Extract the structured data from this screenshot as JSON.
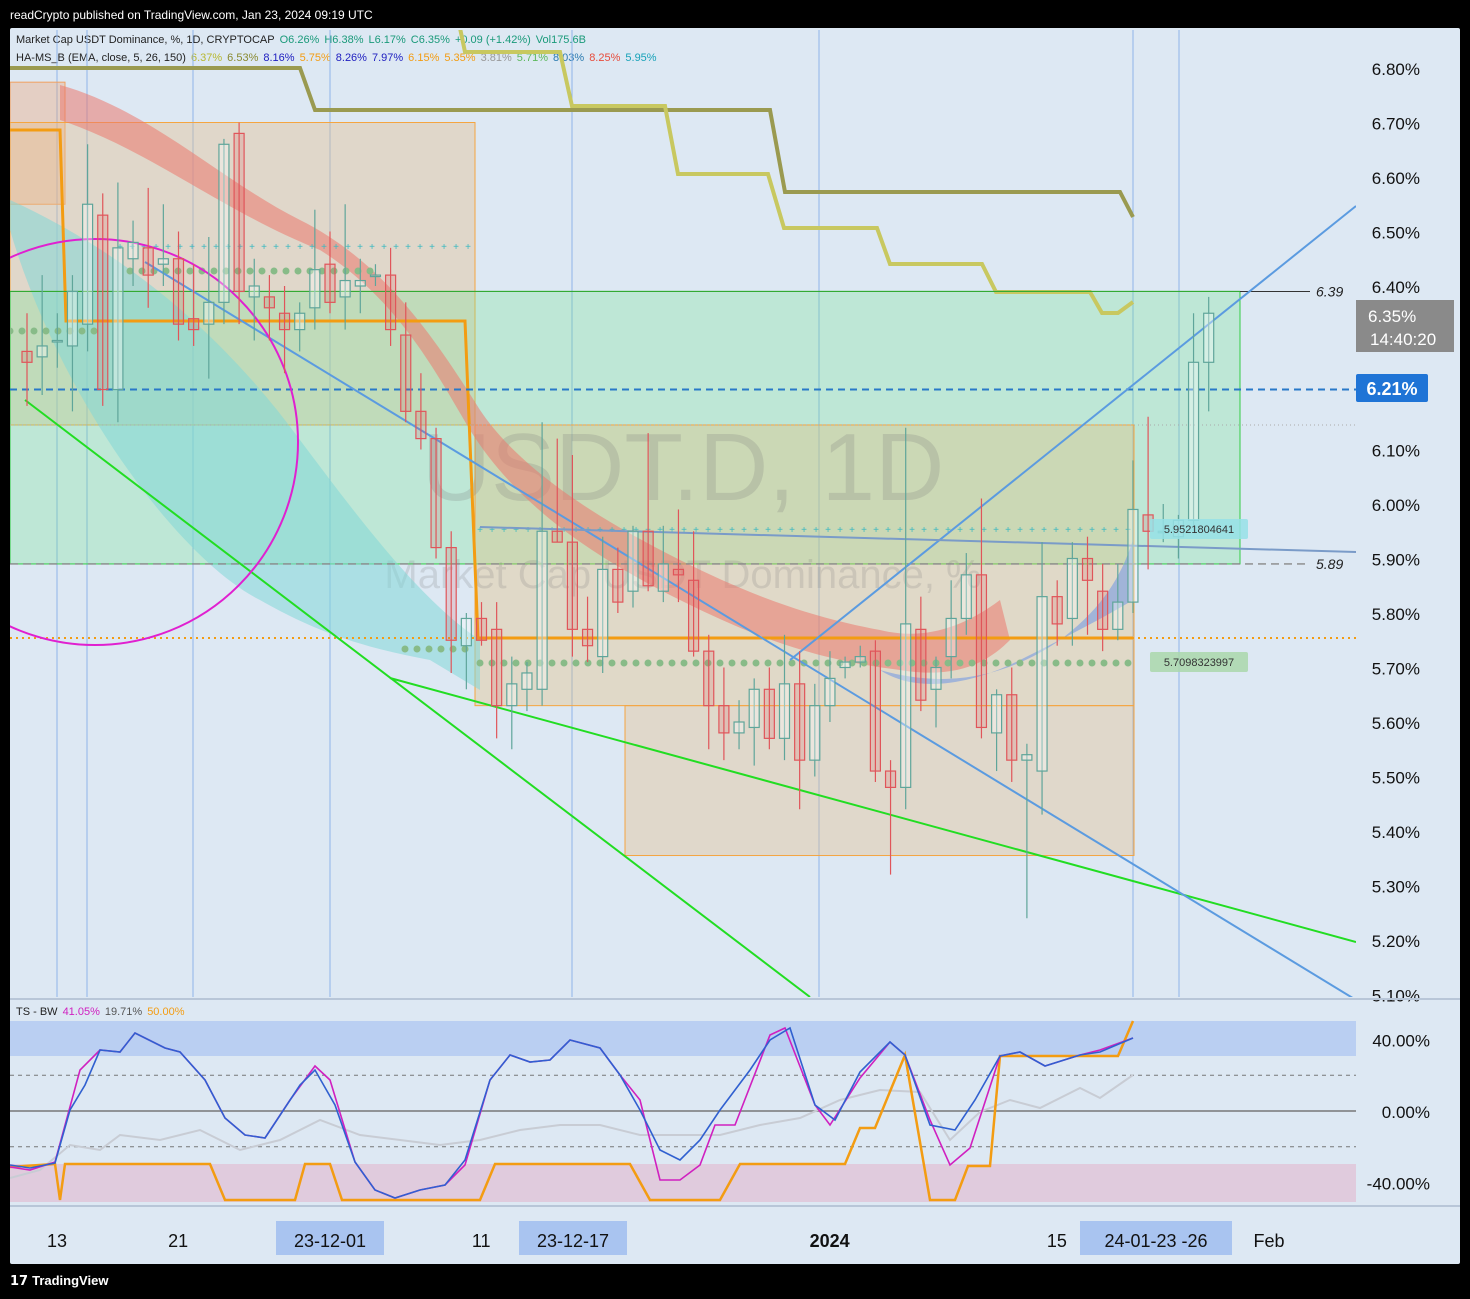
{
  "header": {
    "text": "readCrypto published on TradingView.com, Jan 23, 2024 09:19 UTC"
  },
  "footer": {
    "brand": "TradingView",
    "logo_glyph": "17"
  },
  "legend": {
    "line1": [
      {
        "t": "Market Cap USDT Dominance, %, 1D, CRYPTOCAP",
        "c": "#222"
      },
      {
        "t": "O6.26%",
        "c": "#1a9a7a"
      },
      {
        "t": "H6.38%",
        "c": "#1a9a7a"
      },
      {
        "t": "L6.17%",
        "c": "#1a9a7a"
      },
      {
        "t": "C6.35%",
        "c": "#1a9a7a"
      },
      {
        "t": "+0.09 (+1.42%)",
        "c": "#1a9a7a"
      },
      {
        "t": "Vol175.6B",
        "c": "#1a9a7a"
      }
    ],
    "line2": [
      {
        "t": "HA-MS_B (EMA, close, 5, 26, 150)",
        "c": "#222"
      },
      {
        "t": "6.37%",
        "c": "#b8b830"
      },
      {
        "t": "6.53%",
        "c": "#8a8a30"
      },
      {
        "t": "8.16%",
        "c": "#2020c0"
      },
      {
        "t": "5.75%",
        "c": "#f39c12"
      },
      {
        "t": "8.26%",
        "c": "#2020c0"
      },
      {
        "t": "7.97%",
        "c": "#2020c0"
      },
      {
        "t": "6.15%",
        "c": "#f39c12"
      },
      {
        "t": "5.35%",
        "c": "#f39c12"
      },
      {
        "t": "3.81%",
        "c": "#999999"
      },
      {
        "t": "5.71%",
        "c": "#5cb85c"
      },
      {
        "t": "8.03%",
        "c": "#2a7ab0"
      },
      {
        "t": "8.25%",
        "c": "#e74c3c"
      },
      {
        "t": "5.95%",
        "c": "#17a2b8"
      }
    ],
    "osc": [
      {
        "t": "TS - BW",
        "c": "#222"
      },
      {
        "t": "41.05%",
        "c": "#d020c0"
      },
      {
        "t": "19.71%",
        "c": "#555555"
      },
      {
        "t": "50.00%",
        "c": "#f39c12"
      }
    ]
  },
  "watermark": {
    "symbol": "USDT.D, 1D",
    "name": "Market Cap USDT Dominance, %"
  },
  "chart_data": {
    "type": "candlestick",
    "y_axis": {
      "ticks": [
        "6.80%",
        "6.70%",
        "6.60%",
        "6.50%",
        "6.40%",
        "6.10%",
        "6.00%",
        "5.90%",
        "5.80%",
        "5.70%",
        "5.60%",
        "5.50%",
        "5.40%",
        "5.30%",
        "5.20%",
        "5.10%"
      ],
      "tick_values": [
        6.8,
        6.7,
        6.6,
        6.5,
        6.4,
        6.1,
        6.0,
        5.9,
        5.8,
        5.7,
        5.6,
        5.5,
        5.4,
        5.3,
        5.2,
        5.1
      ],
      "range": [
        5.08,
        6.86
      ]
    },
    "x_axis": {
      "labels": [
        "13",
        "21",
        "11",
        "2024",
        "15",
        "Feb"
      ],
      "label_days": [
        0,
        8,
        28,
        51,
        66,
        80
      ],
      "highlight_labels": [
        "23-12-01",
        "23-12-17",
        "24-01-23  -26"
      ]
    },
    "candles": [
      {
        "o": 6.28,
        "h": 6.35,
        "l": 6.18,
        "c": 6.26
      },
      {
        "o": 6.27,
        "h": 6.42,
        "l": 6.2,
        "c": 6.29
      },
      {
        "o": 6.3,
        "h": 6.35,
        "l": 6.25,
        "c": 6.3
      },
      {
        "o": 6.29,
        "h": 6.42,
        "l": 6.17,
        "c": 6.39
      },
      {
        "o": 6.33,
        "h": 6.66,
        "l": 6.28,
        "c": 6.55
      },
      {
        "o": 6.53,
        "h": 6.57,
        "l": 6.18,
        "c": 6.21
      },
      {
        "o": 6.21,
        "h": 6.59,
        "l": 6.15,
        "c": 6.47
      },
      {
        "o": 6.45,
        "h": 6.52,
        "l": 6.4,
        "c": 6.48
      },
      {
        "o": 6.47,
        "h": 6.58,
        "l": 6.36,
        "c": 6.42
      },
      {
        "o": 6.44,
        "h": 6.55,
        "l": 6.4,
        "c": 6.45
      },
      {
        "o": 6.45,
        "h": 6.5,
        "l": 6.3,
        "c": 6.33
      },
      {
        "o": 6.34,
        "h": 6.44,
        "l": 6.29,
        "c": 6.32
      },
      {
        "o": 6.33,
        "h": 6.49,
        "l": 6.23,
        "c": 6.37
      },
      {
        "o": 6.37,
        "h": 6.67,
        "l": 6.33,
        "c": 6.66
      },
      {
        "o": 6.68,
        "h": 6.7,
        "l": 6.33,
        "c": 6.39
      },
      {
        "o": 6.38,
        "h": 6.45,
        "l": 6.3,
        "c": 6.4
      },
      {
        "o": 6.38,
        "h": 6.42,
        "l": 6.3,
        "c": 6.36
      },
      {
        "o": 6.35,
        "h": 6.4,
        "l": 6.24,
        "c": 6.32
      },
      {
        "o": 6.32,
        "h": 6.37,
        "l": 6.28,
        "c": 6.35
      },
      {
        "o": 6.36,
        "h": 6.54,
        "l": 6.32,
        "c": 6.43
      },
      {
        "o": 6.44,
        "h": 6.5,
        "l": 6.35,
        "c": 6.37
      },
      {
        "o": 6.38,
        "h": 6.55,
        "l": 6.32,
        "c": 6.41
      },
      {
        "o": 6.4,
        "h": 6.45,
        "l": 6.35,
        "c": 6.41
      },
      {
        "o": 6.42,
        "h": 6.44,
        "l": 6.4,
        "c": 6.42
      },
      {
        "o": 6.42,
        "h": 6.47,
        "l": 6.29,
        "c": 6.32
      },
      {
        "o": 6.31,
        "h": 6.37,
        "l": 6.15,
        "c": 6.17
      },
      {
        "o": 6.17,
        "h": 6.24,
        "l": 6.1,
        "c": 6.12
      },
      {
        "o": 6.12,
        "h": 6.14,
        "l": 5.9,
        "c": 5.92
      },
      {
        "o": 5.92,
        "h": 5.95,
        "l": 5.69,
        "c": 5.75
      },
      {
        "o": 5.74,
        "h": 5.8,
        "l": 5.66,
        "c": 5.79
      },
      {
        "o": 5.79,
        "h": 5.82,
        "l": 5.74,
        "c": 5.75
      },
      {
        "o": 5.77,
        "h": 5.82,
        "l": 5.57,
        "c": 5.63
      },
      {
        "o": 5.63,
        "h": 5.72,
        "l": 5.55,
        "c": 5.67
      },
      {
        "o": 5.66,
        "h": 5.71,
        "l": 5.62,
        "c": 5.69
      },
      {
        "o": 5.66,
        "h": 6.15,
        "l": 5.63,
        "c": 5.95
      },
      {
        "o": 5.95,
        "h": 6.12,
        "l": 5.93,
        "c": 5.93
      },
      {
        "o": 5.93,
        "h": 6.09,
        "l": 5.72,
        "c": 5.77
      },
      {
        "o": 5.77,
        "h": 5.83,
        "l": 5.71,
        "c": 5.74
      },
      {
        "o": 5.72,
        "h": 5.94,
        "l": 5.69,
        "c": 5.88
      },
      {
        "o": 5.88,
        "h": 5.92,
        "l": 5.8,
        "c": 5.82
      },
      {
        "o": 5.84,
        "h": 5.96,
        "l": 5.81,
        "c": 5.95
      },
      {
        "o": 5.95,
        "h": 6.13,
        "l": 5.84,
        "c": 5.85
      },
      {
        "o": 5.84,
        "h": 5.96,
        "l": 5.82,
        "c": 5.89
      },
      {
        "o": 5.88,
        "h": 5.99,
        "l": 5.82,
        "c": 5.87
      },
      {
        "o": 5.86,
        "h": 5.95,
        "l": 5.72,
        "c": 5.73
      },
      {
        "o": 5.73,
        "h": 5.76,
        "l": 5.55,
        "c": 5.63
      },
      {
        "o": 5.63,
        "h": 5.7,
        "l": 5.53,
        "c": 5.58
      },
      {
        "o": 5.58,
        "h": 5.64,
        "l": 5.55,
        "c": 5.6
      },
      {
        "o": 5.59,
        "h": 5.68,
        "l": 5.52,
        "c": 5.66
      },
      {
        "o": 5.66,
        "h": 5.7,
        "l": 5.55,
        "c": 5.57
      },
      {
        "o": 5.57,
        "h": 5.76,
        "l": 5.53,
        "c": 5.67
      },
      {
        "o": 5.67,
        "h": 5.73,
        "l": 5.44,
        "c": 5.53
      },
      {
        "o": 5.53,
        "h": 5.67,
        "l": 5.5,
        "c": 5.63
      },
      {
        "o": 5.63,
        "h": 5.73,
        "l": 5.6,
        "c": 5.68
      },
      {
        "o": 5.7,
        "h": 5.72,
        "l": 5.68,
        "c": 5.71
      },
      {
        "o": 5.71,
        "h": 5.74,
        "l": 5.7,
        "c": 5.72
      },
      {
        "o": 5.73,
        "h": 5.75,
        "l": 5.49,
        "c": 5.51
      },
      {
        "o": 5.51,
        "h": 5.53,
        "l": 5.32,
        "c": 5.48
      },
      {
        "o": 5.48,
        "h": 6.14,
        "l": 5.44,
        "c": 5.78
      },
      {
        "o": 5.77,
        "h": 5.83,
        "l": 5.62,
        "c": 5.64
      },
      {
        "o": 5.66,
        "h": 5.72,
        "l": 5.59,
        "c": 5.7
      },
      {
        "o": 5.72,
        "h": 5.86,
        "l": 5.68,
        "c": 5.79
      },
      {
        "o": 5.79,
        "h": 5.91,
        "l": 5.76,
        "c": 5.87
      },
      {
        "o": 5.87,
        "h": 6.01,
        "l": 5.57,
        "c": 5.59
      },
      {
        "o": 5.58,
        "h": 5.66,
        "l": 5.51,
        "c": 5.65
      },
      {
        "o": 5.65,
        "h": 5.7,
        "l": 5.49,
        "c": 5.53
      },
      {
        "o": 5.53,
        "h": 5.56,
        "l": 5.24,
        "c": 5.54
      },
      {
        "o": 5.51,
        "h": 5.93,
        "l": 5.43,
        "c": 5.83
      },
      {
        "o": 5.83,
        "h": 5.86,
        "l": 5.74,
        "c": 5.78
      },
      {
        "o": 5.79,
        "h": 5.93,
        "l": 5.74,
        "c": 5.9
      },
      {
        "o": 5.9,
        "h": 5.94,
        "l": 5.76,
        "c": 5.86
      },
      {
        "o": 5.84,
        "h": 5.89,
        "l": 5.73,
        "c": 5.77
      },
      {
        "o": 5.77,
        "h": 5.89,
        "l": 5.75,
        "c": 5.82
      },
      {
        "o": 5.82,
        "h": 6.08,
        "l": 5.8,
        "c": 5.99
      },
      {
        "o": 5.98,
        "h": 6.16,
        "l": 5.88,
        "c": 5.95
      },
      {
        "o": 5.95,
        "h": 6.0,
        "l": 5.93,
        "c": 5.95
      },
      {
        "o": 5.94,
        "h": 5.98,
        "l": 5.9,
        "c": 5.97
      },
      {
        "o": 5.97,
        "h": 6.35,
        "l": 5.95,
        "c": 6.26
      },
      {
        "o": 6.26,
        "h": 6.38,
        "l": 6.17,
        "c": 6.35
      }
    ],
    "levels": {
      "price_label": "6.35%",
      "countdown": "14:40:20",
      "dashed_line": "6.21%",
      "resistance": "6.39",
      "support": "5.89",
      "cyan_dots": "5.9521804641",
      "green_dots": "5.7098323997"
    },
    "oscillator": {
      "name": "TS - BW",
      "ticks": [
        "40.00%",
        "0.00%",
        "-40.00%"
      ],
      "tick_values": [
        40,
        0,
        -40
      ],
      "range": [
        -53,
        50
      ],
      "series": [
        {
          "name": "41.05%",
          "color": "#d020c0"
        },
        {
          "name": "19.71%",
          "color": "#aaaaaa"
        },
        {
          "name": "50.00%",
          "color": "#f39c12"
        },
        {
          "name": "",
          "color": "#3060d0"
        }
      ]
    },
    "colors": {
      "up": "#5fa59a",
      "down": "#e0555a",
      "green_line": "#22dd22",
      "trend_blue": "#5b9be0",
      "magenta": "#e020d0",
      "olive": "#9a9a50",
      "lime": "#c8c860",
      "orange": "#f39c12",
      "label_blue": "#1f74d6"
    }
  }
}
